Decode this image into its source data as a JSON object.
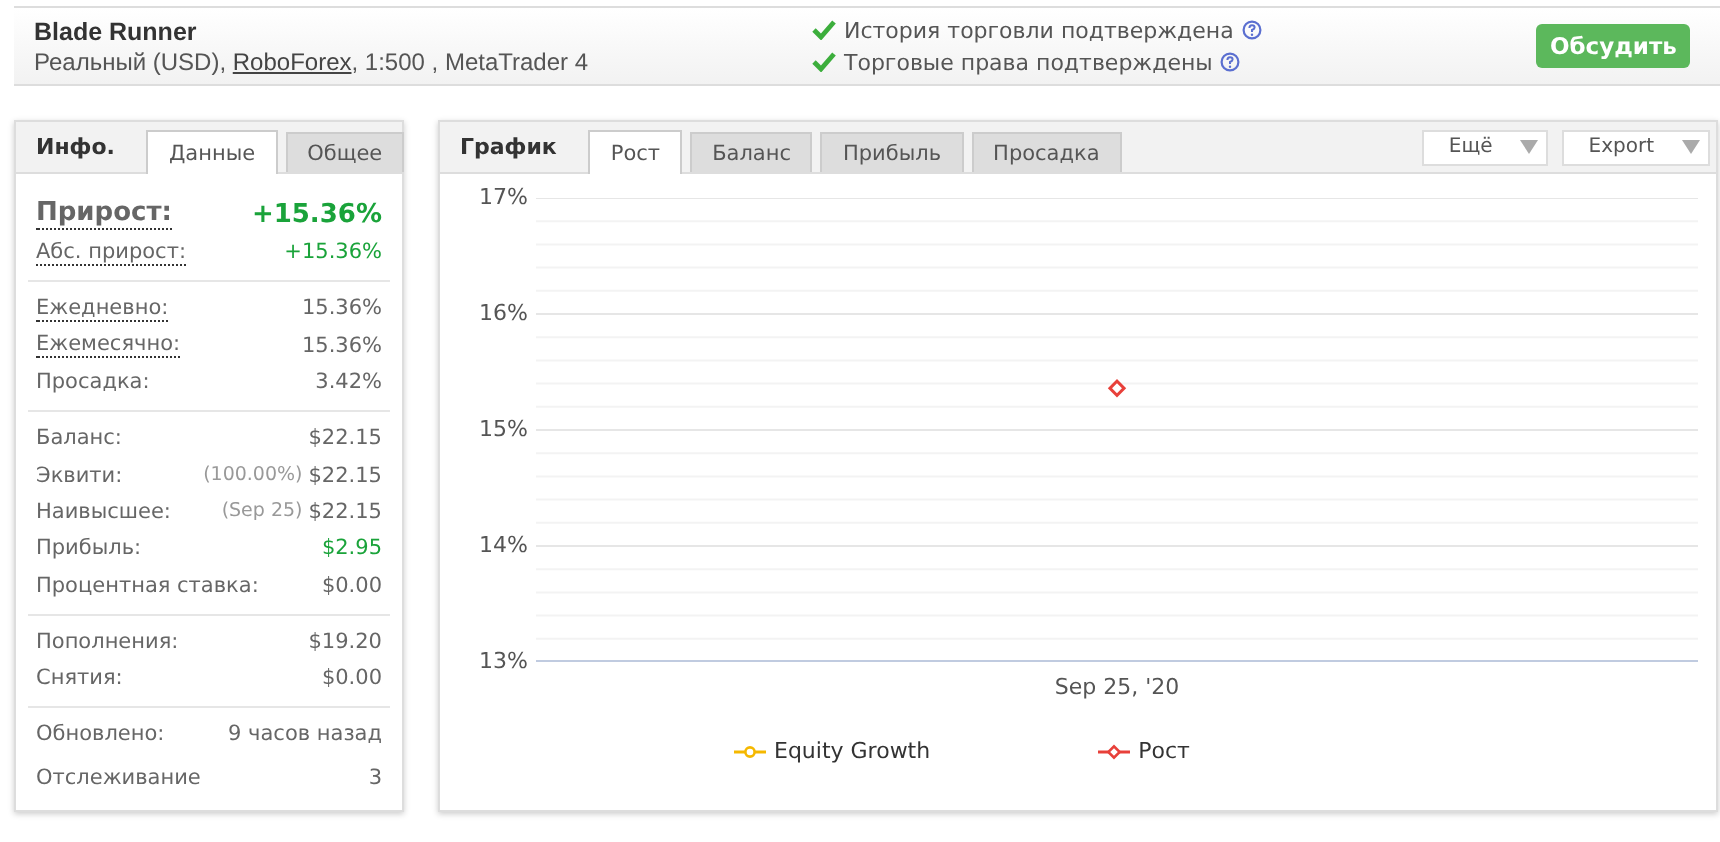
{
  "header": {
    "title": "Blade Runner",
    "subtitle_parts": [
      {
        "text": "Реальный (USD), ",
        "link": false
      },
      {
        "text": "RoboForex",
        "link": true
      },
      {
        "text": ", 1:500 , MetaTrader 4",
        "link": false
      }
    ],
    "verifications": [
      {
        "label": "История торговли подтверждена",
        "checked": true
      },
      {
        "label": "Торговые права подтверждены",
        "checked": true
      }
    ],
    "discuss_button": "Обсудить"
  },
  "info_panel": {
    "title": "Инфо.",
    "tabs": [
      {
        "label": "Данные",
        "selected": true
      },
      {
        "label": "Общее",
        "selected": false
      }
    ],
    "sections": [
      [
        {
          "label": "Прирост:",
          "value": "+15.36%",
          "kind": "headline",
          "dotted": true,
          "positive": true
        },
        {
          "label": "Абс. прирост:",
          "value": "+15.36%",
          "kind": "row",
          "dotted": true,
          "positive": true
        }
      ],
      [
        {
          "label": "Ежедневно:",
          "value": "15.36%",
          "kind": "row",
          "dotted": true,
          "positive": false
        },
        {
          "label": "Ежемесячно:",
          "value": "15.36%",
          "kind": "row",
          "dotted": true,
          "positive": false
        },
        {
          "label": "Просадка:",
          "value": "3.42%",
          "kind": "row",
          "dotted": false,
          "positive": false
        }
      ],
      [
        {
          "label": "Баланс:",
          "value": "$22.15",
          "kind": "row",
          "dotted": false,
          "positive": false
        },
        {
          "label": "Эквити:",
          "note": "(100.00%)",
          "value": "$22.15",
          "kind": "row",
          "dotted": false,
          "positive": false
        },
        {
          "label": "Наивысшее:",
          "note": "(Sep 25)",
          "value": "$22.15",
          "kind": "row",
          "dotted": false,
          "positive": false
        },
        {
          "label": "Прибыль:",
          "value": "$2.95",
          "kind": "row",
          "dotted": false,
          "positive": true
        },
        {
          "label": "Процентная ставка:",
          "value": "$0.00",
          "kind": "row",
          "dotted": false,
          "positive": false
        }
      ],
      [
        {
          "label": "Пополнения:",
          "value": "$19.20",
          "kind": "row",
          "dotted": false,
          "positive": false
        },
        {
          "label": "Снятия:",
          "value": "$0.00",
          "kind": "row",
          "dotted": false,
          "positive": false
        }
      ],
      [
        {
          "label": "Обновлено:",
          "value": "9 часов назад",
          "kind": "row",
          "dotted": false,
          "positive": false
        },
        {
          "label": "Отслеживание",
          "value": "3",
          "kind": "tall",
          "dotted": false,
          "positive": false
        }
      ]
    ]
  },
  "chart_panel": {
    "title": "График",
    "tabs": [
      {
        "label": "Рост",
        "selected": true
      },
      {
        "label": "Баланс",
        "selected": false
      },
      {
        "label": "Прибыль",
        "selected": false
      },
      {
        "label": "Просадка",
        "selected": false
      }
    ],
    "dropdowns": [
      "Ещё",
      "Export"
    ],
    "chart_data": {
      "type": "line",
      "grid": true,
      "x": [
        "Sep 25, '20"
      ],
      "ylim": [
        13,
        17
      ],
      "yticks": [
        {
          "value": 13,
          "label": "13%"
        },
        {
          "value": 14,
          "label": "14%"
        },
        {
          "value": 15,
          "label": "15%"
        },
        {
          "value": 16,
          "label": "16%"
        },
        {
          "value": 17,
          "label": "17%"
        }
      ],
      "series": [
        {
          "name": "Equity Growth",
          "color": "#f5b800",
          "marker": "circle",
          "values": [
            null
          ]
        },
        {
          "name": "Рост",
          "color": "#e8403a",
          "marker": "diamond",
          "values": [
            15.36
          ]
        }
      ]
    }
  }
}
